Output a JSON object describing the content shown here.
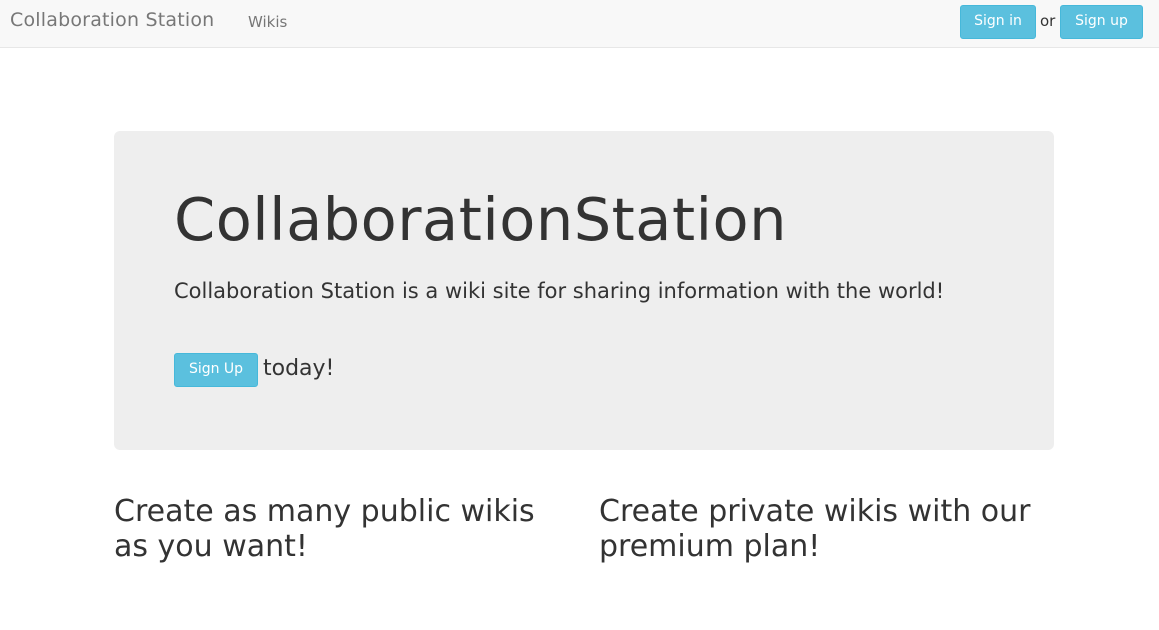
{
  "navbar": {
    "brand": "Collaboration Station",
    "links": [
      {
        "label": "Wikis"
      }
    ],
    "sign_in_label": "Sign in",
    "or_text": "or",
    "sign_up_label": "Sign up"
  },
  "jumbotron": {
    "title": "CollaborationStation",
    "lead": "Collaboration Station is a wiki site for sharing information with the world!",
    "cta_button_label": "Sign Up",
    "cta_suffix": "today!"
  },
  "features": [
    {
      "heading": "Create as many public wikis as you want!"
    },
    {
      "heading": "Create private wikis with our premium plan!"
    }
  ],
  "colors": {
    "navbar_bg": "#f8f8f8",
    "button_info": "#5bc0de",
    "jumbotron_bg": "#eeeeee",
    "text": "#333333",
    "nav_text": "#777777"
  }
}
